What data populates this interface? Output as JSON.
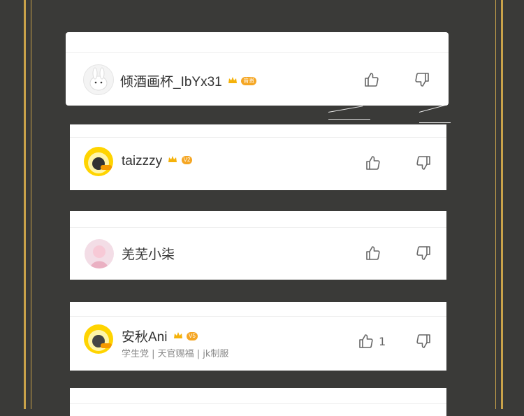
{
  "comments": [
    {
      "username": "倾酒画杯_IbYx31",
      "level": "音贵",
      "likes": ""
    },
    {
      "username": "taizzzy",
      "level": "V2",
      "likes": ""
    },
    {
      "username": "羌芜小柒",
      "level": "",
      "likes": ""
    },
    {
      "username": "安秋Ani",
      "level": "V5",
      "likes": "1",
      "subtitle": "学生党 | 天官赐福 | jk制服"
    }
  ],
  "icons": {
    "like": "thumbs-up-icon",
    "dislike": "thumbs-down-icon"
  },
  "colors": {
    "background": "#3a3a38",
    "frame_gold": "#c9a24a",
    "level_badge": "#f5a623"
  }
}
